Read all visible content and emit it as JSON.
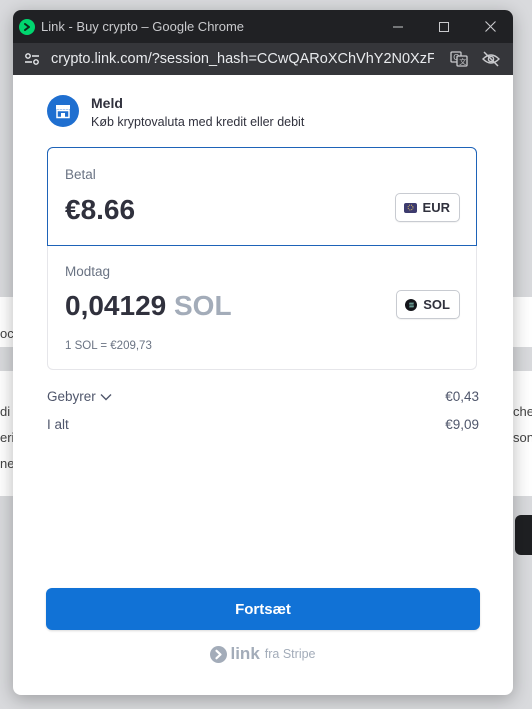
{
  "window": {
    "title": "Link - Buy crypto – Google Chrome",
    "url": "crypto.link.com/?session_hash=CCwQARoXChVhY2N0XzFKa..."
  },
  "background": {
    "frag_1": "oc",
    "frag_2": "di",
    "frag_3": "eri",
    "frag_4": "ne",
    "frag_5": "che",
    "frag_6": "son"
  },
  "merchant": {
    "name": "Meld",
    "subtitle": "Køb kryptovaluta med kredit eller debit"
  },
  "pay": {
    "label": "Betal",
    "amount": "€8.66",
    "currency": "EUR"
  },
  "receive": {
    "label": "Modtag",
    "amount": "0,04129",
    "unit": "SOL",
    "currency": "SOL",
    "rate": "1 SOL = €209,73"
  },
  "fees": {
    "label": "Gebyrer",
    "value": "€0,43",
    "total_label": "I alt",
    "total_value": "€9,09"
  },
  "continue_label": "Fortsæt",
  "footer": {
    "logo": "link",
    "by": "fra Stripe"
  },
  "colors": {
    "accent": "#1172d6",
    "focus_border": "#1e63b8",
    "link_green": "#00d66f"
  }
}
